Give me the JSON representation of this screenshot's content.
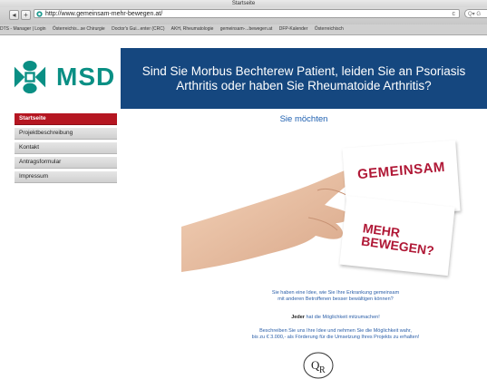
{
  "browser": {
    "window_title": "Startseite",
    "nav_buttons": [
      "◂",
      "+"
    ],
    "url": "http://www.gemeinsam-mehr-bewegen.at/",
    "reload": "c",
    "search_placeholder": "Q▾ G",
    "bookmarks": [
      "DTS - Manager | Login",
      "Österreichis...se Chirurgie",
      "Doctor's Gui...enter (CRC)",
      "AKH, Rheumatologie",
      "gemeinsam-...bewegen.at",
      "DFP-Kalender",
      "Österreichisch"
    ]
  },
  "logo": {
    "text": "MSD",
    "brand_color": "#0a8f84"
  },
  "banner": {
    "text": "Sind Sie Morbus Bechterew Patient, leiden Sie an Psoriasis Arthritis oder haben Sie Rheumatoide Arthritis?",
    "bg_color": "#15477f"
  },
  "nav": {
    "items": [
      {
        "label": "Startseite",
        "active": true
      },
      {
        "label": "Projektbeschreibung",
        "active": false
      },
      {
        "label": "Kontakt",
        "active": false
      },
      {
        "label": "Antragsformular",
        "active": false
      },
      {
        "label": "Impressum",
        "active": false
      }
    ],
    "active_color": "#b51621"
  },
  "main": {
    "headline": "Sie möchten",
    "card1_text": "GEMEINSAM",
    "card2_line1": "MEHR",
    "card2_line2": "BEWEGEN?",
    "p1_line1": "Sie haben eine Idee, wie Sie Ihre Erkrankung gemeinsam",
    "p1_line2": "mit anderen Betroffenen besser bewältigen können?",
    "p2_bold": "Jeder",
    "p2_rest": " hat die Möglichkeit mitzumachen!",
    "p3_line1": "Beschreiben Sie uns Ihre Idee und nehmen Sie die Möglichkeit wahr,",
    "p3_line2": "bis zu € 3.000,- als Förderung für die Umsetzung Ihres Projekts zu erhalten!",
    "seal_text": "QR"
  }
}
